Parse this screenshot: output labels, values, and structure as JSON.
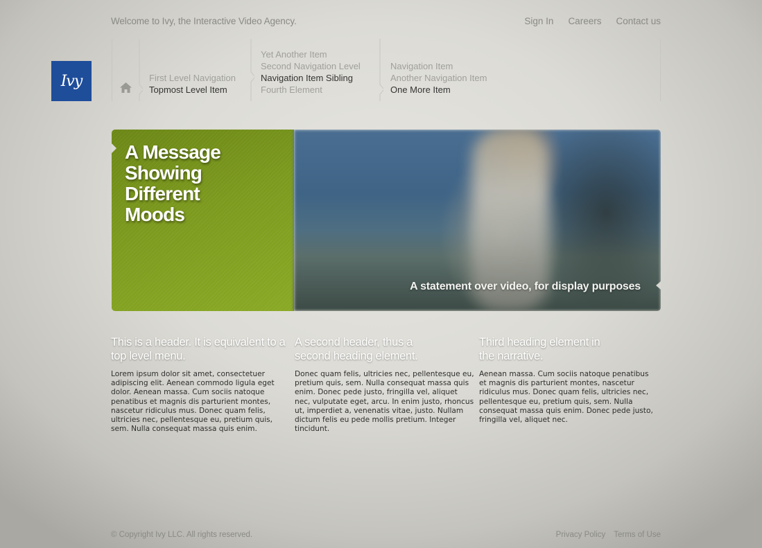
{
  "header": {
    "tagline": "Welcome to Ivy, the Interactive Video Agency.",
    "links": [
      "Sign In",
      "Careers",
      "Contact us"
    ]
  },
  "logo": {
    "text": "Ivy",
    "color": "#1e4d9a"
  },
  "nav": {
    "home_icon": "home-icon",
    "col1": [
      "First Level Navigation",
      "Topmost Level Item"
    ],
    "col2": [
      "Yet Another Item",
      "Second Navigation Level",
      "Navigation Item Sibling",
      "Fourth Element"
    ],
    "col3": [
      "Navigation Item",
      "Another Navigation Item",
      "One More Item"
    ]
  },
  "hero": {
    "message": "A Message Showing Different Moods",
    "statement": "A statement over video, for display purposes",
    "green": "#7c9a1e"
  },
  "columns": [
    {
      "heading": "This is a header. It is equivalent to a top level menu.",
      "body": "Lorem ipsum dolor sit amet, consectetuer adipiscing elit. Aenean commodo ligula eget dolor. Aenean massa. Cum sociis natoque penatibus et magnis dis parturient montes, nascetur ridiculus mus. Donec quam felis, ultricies nec, pellentesque eu, pretium quis, sem. Nulla consequat massa quis enim."
    },
    {
      "heading": "A second header, thus a second heading element.",
      "body": "Donec quam felis, ultricies nec, pellentesque eu, pretium quis, sem. Nulla consequat massa quis enim. Donec pede justo, fringilla vel, aliquet nec, vulputate eget, arcu. In enim justo, rhoncus ut, imperdiet a, venenatis vitae, justo. Nullam dictum felis eu pede mollis pretium. Integer tincidunt."
    },
    {
      "heading": "Third heading element in the narrative.",
      "body": "Aenean massa. Cum sociis natoque penatibus et magnis dis parturient montes, nascetur ridiculus mus. Donec quam felis, ultricies nec, pellentesque eu, pretium quis, sem. Nulla consequat massa quis enim. Donec pede justo, fringilla vel, aliquet nec."
    }
  ],
  "footer": {
    "copyright": "© Copyright Ivy LLC. All rights reserved.",
    "links": [
      "Privacy Policy",
      "Terms of Use"
    ]
  }
}
